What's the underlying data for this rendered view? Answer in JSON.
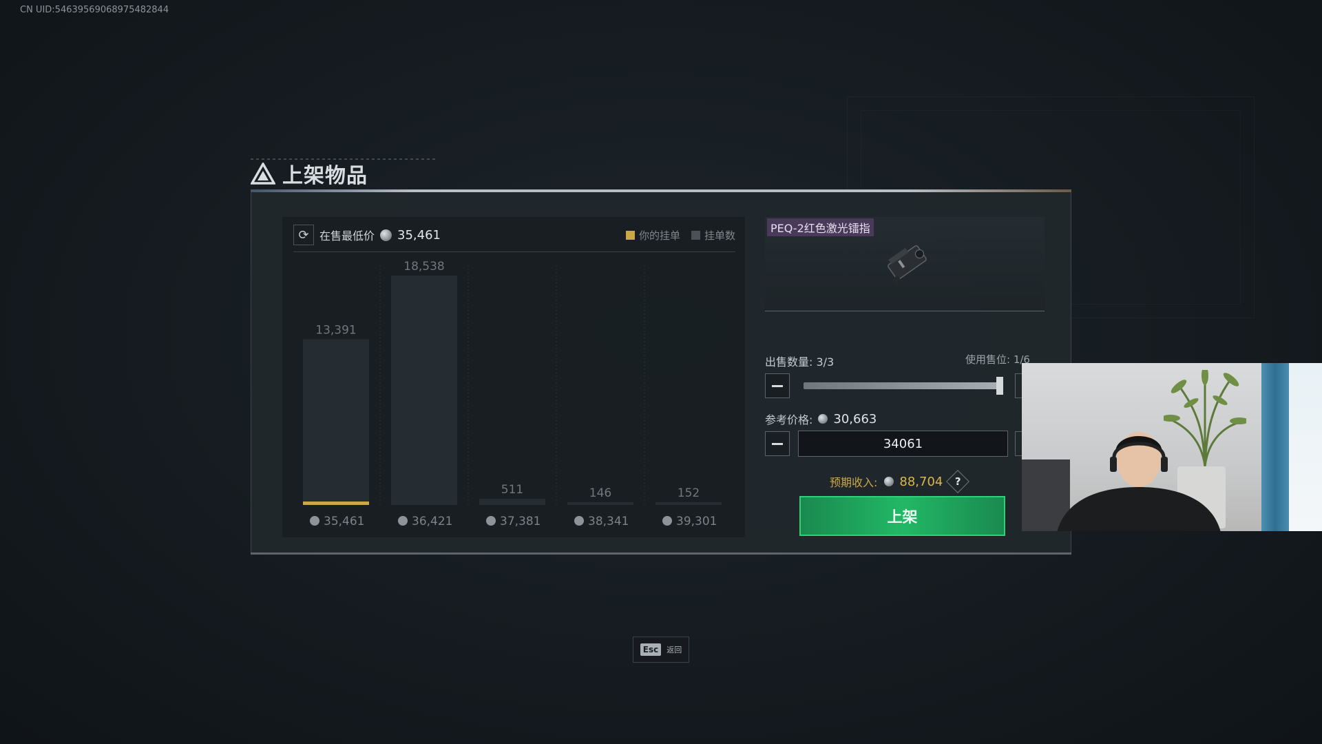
{
  "uid_text": "CN UID:5463956906897548​2844",
  "title": "上架物品",
  "chart": {
    "lowest_label": "在售最低价",
    "lowest_value": "35,461",
    "legend_mine": "你的挂单",
    "legend_count": "挂单数"
  },
  "chart_data": {
    "type": "bar",
    "categories": [
      "35,461",
      "36,421",
      "37,381",
      "38,341",
      "39,301"
    ],
    "values": [
      13391,
      18538,
      511,
      146,
      152
    ],
    "value_labels": [
      "13,391",
      "18,538",
      "511",
      "146",
      "152"
    ],
    "own_listing_category": "35,461",
    "title": "",
    "xlabel": "",
    "ylabel": ""
  },
  "item": {
    "name": "PEQ-2红色激光镭指"
  },
  "quantity": {
    "label": "出售数量: 3/3",
    "slot_label": "使用售位: 1/6",
    "slider_fraction": 1.0
  },
  "reference": {
    "label": "参考价格:",
    "value": "30,663"
  },
  "price_input": {
    "value": "34061"
  },
  "expected": {
    "label": "预期收入:",
    "value": "88,704",
    "help": "?"
  },
  "list_button": "上架",
  "esc": {
    "key": "Esc",
    "label": "返回"
  },
  "colors": {
    "accent_green": "#22b866",
    "gold": "#c9a845",
    "item_tag": "#4a3a5a"
  }
}
